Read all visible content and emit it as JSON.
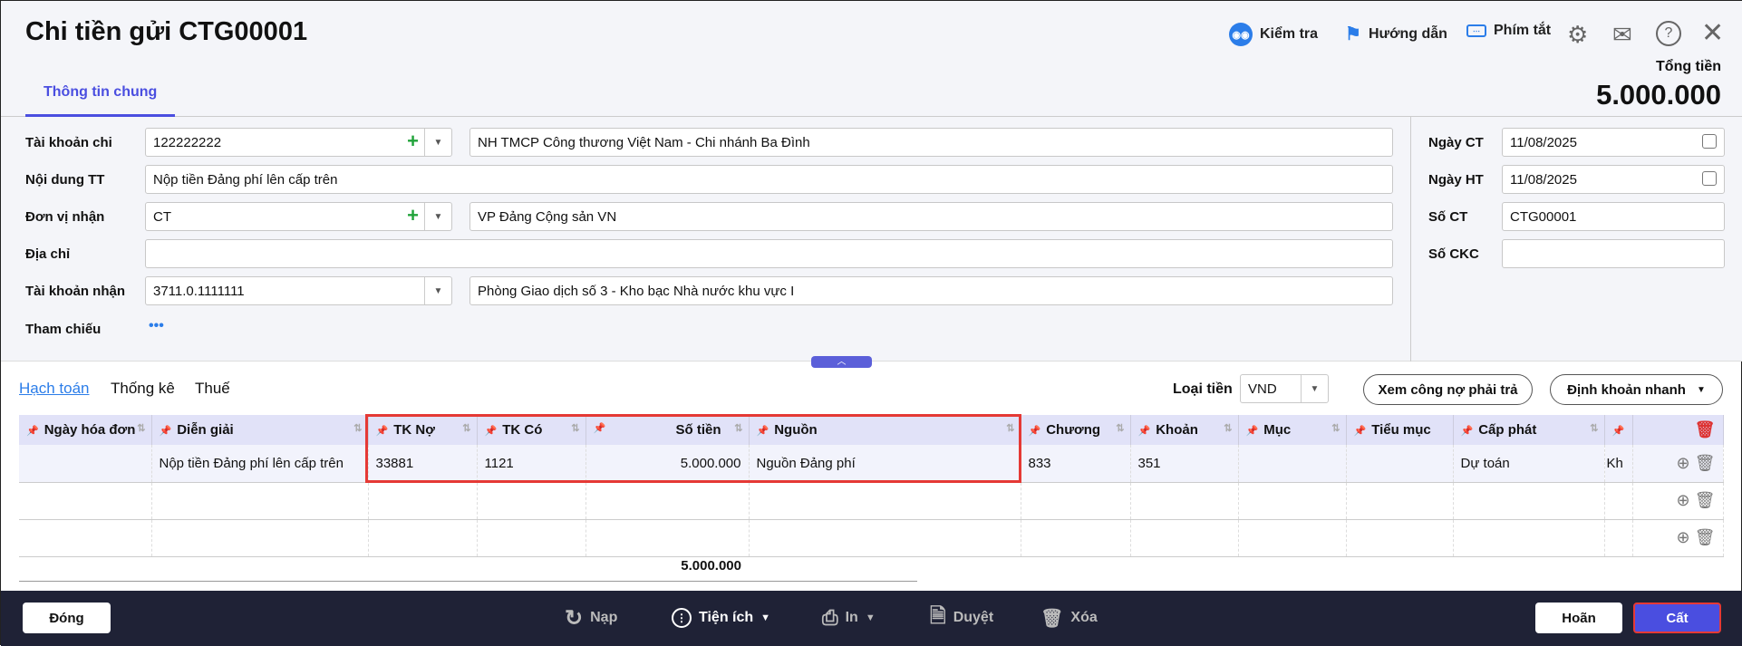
{
  "header": {
    "title": "Chi tiền gửi CTG00001",
    "toolbar": {
      "check": "Kiểm tra",
      "guide": "Hướng dẫn",
      "shortcuts": "Phím tắt"
    },
    "tab": "Thông tin chung",
    "total_label": "Tổng tiền",
    "total_value": "5.000.000"
  },
  "form": {
    "tai_khoan_chi": {
      "label": "Tài khoản chi",
      "value": "122222222",
      "desc": "NH TMCP Công thương Việt Nam - Chi nhánh  Ba Đình"
    },
    "noi_dung": {
      "label": "Nội dung TT",
      "value": "Nộp tiền Đảng phí lên cấp trên"
    },
    "don_vi_nhan": {
      "label": "Đơn vị nhận",
      "value": "CT",
      "desc": "VP Đảng Cộng sản VN"
    },
    "dia_chi": {
      "label": "Địa chỉ",
      "value": ""
    },
    "tai_khoan_nhan": {
      "label": "Tài khoản nhận",
      "value": "3711.0.1111111",
      "desc": "Phòng Giao dịch số 3 - Kho bạc Nhà nước khu vực I"
    },
    "tham_chieu": {
      "label": "Tham chiếu",
      "value": "•••"
    },
    "ngay_ct": {
      "label": "Ngày CT",
      "value": "11/08/2025"
    },
    "ngay_ht": {
      "label": "Ngày HT",
      "value": "11/08/2025"
    },
    "so_ct": {
      "label": "Số CT",
      "value": "CTG00001"
    },
    "so_ckc": {
      "label": "Số CKC",
      "value": ""
    }
  },
  "subtabs": [
    "Hạch toán",
    "Thống kê",
    "Thuế"
  ],
  "currency": {
    "label": "Loại tiền",
    "value": "VND"
  },
  "buttons": {
    "debt": "Xem công nợ phải trả",
    "quick": "Định khoản nhanh"
  },
  "table": {
    "columns": [
      "Ngày hóa đơn",
      "Diễn giải",
      "TK Nợ",
      "TK Có",
      "Số tiền",
      "Nguồn",
      "Chương",
      "Khoản",
      "Mục",
      "Tiểu mục",
      "Cấp phát",
      ""
    ],
    "rows": [
      [
        "",
        "Nộp tiền Đảng phí lên cấp trên",
        "33881",
        "1121",
        "5.000.000",
        "Nguồn Đảng phí",
        "833",
        "351",
        "",
        "",
        "Dự toán",
        "Kh"
      ]
    ],
    "total": "5.000.000"
  },
  "footer": {
    "close": "Đóng",
    "reload": "Nạp",
    "utilities": "Tiện ích",
    "print": "In",
    "approve": "Duyệt",
    "delete": "Xóa",
    "postpone": "Hoãn",
    "save": "Cất"
  },
  "colors": {
    "accent": "#4a4ee0",
    "footer": "#1f2236",
    "highlight": "#e53935"
  }
}
